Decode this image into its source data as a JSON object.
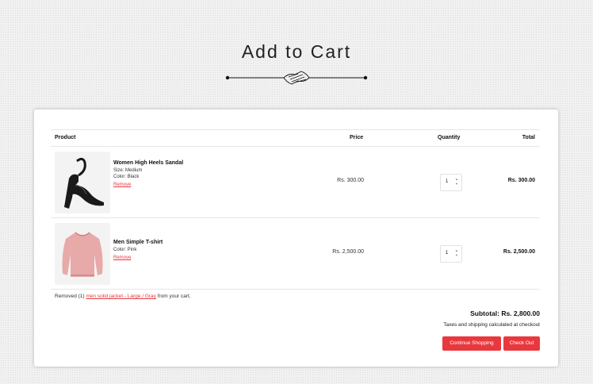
{
  "page": {
    "title": "Add to Cart"
  },
  "table": {
    "headers": {
      "product": "Product",
      "price": "Price",
      "quantity": "Quantity",
      "total": "Total"
    },
    "items": [
      {
        "name": "Women High Heels Sandal",
        "size": "Size: Medium",
        "color": "Color: Black",
        "remove": "Remove",
        "price": "Rs. 300.00",
        "quantity": "1",
        "total": "Rs. 300.00",
        "image_icon": "sandal-icon"
      },
      {
        "name": "Men Simple T-shirt",
        "color": "Color: Pink",
        "remove": "Remove",
        "price": "Rs. 2,500.00",
        "quantity": "1",
        "total": "Rs. 2,500.00",
        "image_icon": "sweater-icon"
      }
    ]
  },
  "removed_notice": {
    "prefix": "Removed (1)",
    "link": "men solid jacket - Large / Gray",
    "suffix": "from your cart."
  },
  "summary": {
    "subtotal": "Subtotal: Rs. 2,800.00",
    "taxes": "Taxes and shipping calculated at checkout"
  },
  "buttons": {
    "continue": "Continue Shopping",
    "checkout": "Check Out"
  },
  "colors": {
    "accent": "#e8383d",
    "sweater": "#e8a9a9"
  }
}
